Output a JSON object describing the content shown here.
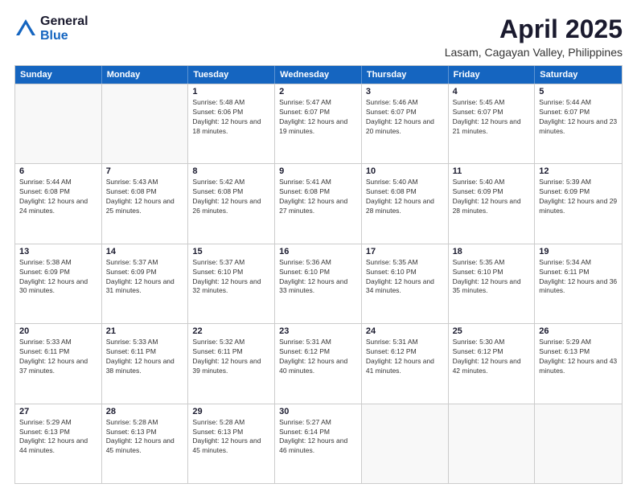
{
  "header": {
    "logo_general": "General",
    "logo_blue": "Blue",
    "month_year": "April 2025",
    "location": "Lasam, Cagayan Valley, Philippines"
  },
  "weekdays": [
    "Sunday",
    "Monday",
    "Tuesday",
    "Wednesday",
    "Thursday",
    "Friday",
    "Saturday"
  ],
  "rows": [
    [
      {
        "day": "",
        "sunrise": "",
        "sunset": "",
        "daylight": ""
      },
      {
        "day": "",
        "sunrise": "",
        "sunset": "",
        "daylight": ""
      },
      {
        "day": "1",
        "sunrise": "Sunrise: 5:48 AM",
        "sunset": "Sunset: 6:06 PM",
        "daylight": "Daylight: 12 hours and 18 minutes."
      },
      {
        "day": "2",
        "sunrise": "Sunrise: 5:47 AM",
        "sunset": "Sunset: 6:07 PM",
        "daylight": "Daylight: 12 hours and 19 minutes."
      },
      {
        "day": "3",
        "sunrise": "Sunrise: 5:46 AM",
        "sunset": "Sunset: 6:07 PM",
        "daylight": "Daylight: 12 hours and 20 minutes."
      },
      {
        "day": "4",
        "sunrise": "Sunrise: 5:45 AM",
        "sunset": "Sunset: 6:07 PM",
        "daylight": "Daylight: 12 hours and 21 minutes."
      },
      {
        "day": "5",
        "sunrise": "Sunrise: 5:44 AM",
        "sunset": "Sunset: 6:07 PM",
        "daylight": "Daylight: 12 hours and 23 minutes."
      }
    ],
    [
      {
        "day": "6",
        "sunrise": "Sunrise: 5:44 AM",
        "sunset": "Sunset: 6:08 PM",
        "daylight": "Daylight: 12 hours and 24 minutes."
      },
      {
        "day": "7",
        "sunrise": "Sunrise: 5:43 AM",
        "sunset": "Sunset: 6:08 PM",
        "daylight": "Daylight: 12 hours and 25 minutes."
      },
      {
        "day": "8",
        "sunrise": "Sunrise: 5:42 AM",
        "sunset": "Sunset: 6:08 PM",
        "daylight": "Daylight: 12 hours and 26 minutes."
      },
      {
        "day": "9",
        "sunrise": "Sunrise: 5:41 AM",
        "sunset": "Sunset: 6:08 PM",
        "daylight": "Daylight: 12 hours and 27 minutes."
      },
      {
        "day": "10",
        "sunrise": "Sunrise: 5:40 AM",
        "sunset": "Sunset: 6:08 PM",
        "daylight": "Daylight: 12 hours and 28 minutes."
      },
      {
        "day": "11",
        "sunrise": "Sunrise: 5:40 AM",
        "sunset": "Sunset: 6:09 PM",
        "daylight": "Daylight: 12 hours and 28 minutes."
      },
      {
        "day": "12",
        "sunrise": "Sunrise: 5:39 AM",
        "sunset": "Sunset: 6:09 PM",
        "daylight": "Daylight: 12 hours and 29 minutes."
      }
    ],
    [
      {
        "day": "13",
        "sunrise": "Sunrise: 5:38 AM",
        "sunset": "Sunset: 6:09 PM",
        "daylight": "Daylight: 12 hours and 30 minutes."
      },
      {
        "day": "14",
        "sunrise": "Sunrise: 5:37 AM",
        "sunset": "Sunset: 6:09 PM",
        "daylight": "Daylight: 12 hours and 31 minutes."
      },
      {
        "day": "15",
        "sunrise": "Sunrise: 5:37 AM",
        "sunset": "Sunset: 6:10 PM",
        "daylight": "Daylight: 12 hours and 32 minutes."
      },
      {
        "day": "16",
        "sunrise": "Sunrise: 5:36 AM",
        "sunset": "Sunset: 6:10 PM",
        "daylight": "Daylight: 12 hours and 33 minutes."
      },
      {
        "day": "17",
        "sunrise": "Sunrise: 5:35 AM",
        "sunset": "Sunset: 6:10 PM",
        "daylight": "Daylight: 12 hours and 34 minutes."
      },
      {
        "day": "18",
        "sunrise": "Sunrise: 5:35 AM",
        "sunset": "Sunset: 6:10 PM",
        "daylight": "Daylight: 12 hours and 35 minutes."
      },
      {
        "day": "19",
        "sunrise": "Sunrise: 5:34 AM",
        "sunset": "Sunset: 6:11 PM",
        "daylight": "Daylight: 12 hours and 36 minutes."
      }
    ],
    [
      {
        "day": "20",
        "sunrise": "Sunrise: 5:33 AM",
        "sunset": "Sunset: 6:11 PM",
        "daylight": "Daylight: 12 hours and 37 minutes."
      },
      {
        "day": "21",
        "sunrise": "Sunrise: 5:33 AM",
        "sunset": "Sunset: 6:11 PM",
        "daylight": "Daylight: 12 hours and 38 minutes."
      },
      {
        "day": "22",
        "sunrise": "Sunrise: 5:32 AM",
        "sunset": "Sunset: 6:11 PM",
        "daylight": "Daylight: 12 hours and 39 minutes."
      },
      {
        "day": "23",
        "sunrise": "Sunrise: 5:31 AM",
        "sunset": "Sunset: 6:12 PM",
        "daylight": "Daylight: 12 hours and 40 minutes."
      },
      {
        "day": "24",
        "sunrise": "Sunrise: 5:31 AM",
        "sunset": "Sunset: 6:12 PM",
        "daylight": "Daylight: 12 hours and 41 minutes."
      },
      {
        "day": "25",
        "sunrise": "Sunrise: 5:30 AM",
        "sunset": "Sunset: 6:12 PM",
        "daylight": "Daylight: 12 hours and 42 minutes."
      },
      {
        "day": "26",
        "sunrise": "Sunrise: 5:29 AM",
        "sunset": "Sunset: 6:13 PM",
        "daylight": "Daylight: 12 hours and 43 minutes."
      }
    ],
    [
      {
        "day": "27",
        "sunrise": "Sunrise: 5:29 AM",
        "sunset": "Sunset: 6:13 PM",
        "daylight": "Daylight: 12 hours and 44 minutes."
      },
      {
        "day": "28",
        "sunrise": "Sunrise: 5:28 AM",
        "sunset": "Sunset: 6:13 PM",
        "daylight": "Daylight: 12 hours and 45 minutes."
      },
      {
        "day": "29",
        "sunrise": "Sunrise: 5:28 AM",
        "sunset": "Sunset: 6:13 PM",
        "daylight": "Daylight: 12 hours and 45 minutes."
      },
      {
        "day": "30",
        "sunrise": "Sunrise: 5:27 AM",
        "sunset": "Sunset: 6:14 PM",
        "daylight": "Daylight: 12 hours and 46 minutes."
      },
      {
        "day": "",
        "sunrise": "",
        "sunset": "",
        "daylight": ""
      },
      {
        "day": "",
        "sunrise": "",
        "sunset": "",
        "daylight": ""
      },
      {
        "day": "",
        "sunrise": "",
        "sunset": "",
        "daylight": ""
      }
    ]
  ]
}
